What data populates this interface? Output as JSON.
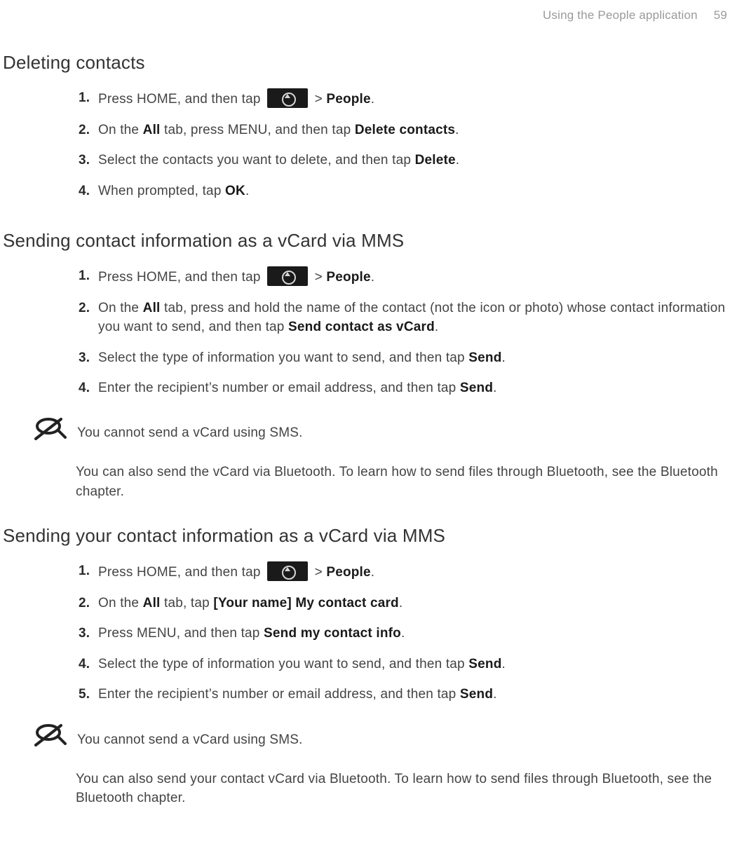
{
  "header": {
    "chapter": "Using the People application",
    "page": "59"
  },
  "heading_deleting": "Deleting contacts",
  "step_d1_a": "Press HOME, and then tap ",
  "step_d1_b": " > ",
  "step_d1_c": "People",
  "step_d1_d": ".",
  "step_d2_a": "On the ",
  "step_d2_b": "All",
  "step_d2_c": " tab, press MENU, and then tap ",
  "step_d2_d": "Delete contacts",
  "step_d2_e": ".",
  "step_d3_a": "Select the contacts you want to delete, and then tap ",
  "step_d3_b": "Delete",
  "step_d3_c": ".",
  "step_d4_a": "When prompted, tap ",
  "step_d4_b": "OK",
  "step_d4_c": ".",
  "heading_sending_contact": "Sending contact information as a vCard via MMS",
  "step_s1_a": "Press HOME, and then tap ",
  "step_s1_b": " > ",
  "step_s1_c": "People",
  "step_s1_d": ".",
  "step_s2_a": "On the ",
  "step_s2_b": "All",
  "step_s2_c": " tab, press and hold the name of the contact (not the icon or photo) whose contact information you want to send, and then tap ",
  "step_s2_d": "Send contact as vCard",
  "step_s2_e": ".",
  "step_s3_a": "Select the type of information you want to send, and then tap ",
  "step_s3_b": "Send",
  "step_s3_c": ".",
  "step_s4_a": "Enter the recipient’s number or email address, and then tap ",
  "step_s4_b": "Send",
  "step_s4_c": ".",
  "note1": "You cannot send a vCard using SMS.",
  "followup1": "You can also send the vCard via Bluetooth. To learn how to send files through Bluetooth, see the Bluetooth chapter.",
  "heading_sending_your": "Sending your contact information as a vCard via MMS",
  "step_y1_a": "Press HOME, and then tap ",
  "step_y1_b": " > ",
  "step_y1_c": "People",
  "step_y1_d": ".",
  "step_y2_a": "On the ",
  "step_y2_b": "All",
  "step_y2_c": " tab, tap ",
  "step_y2_d": "[Your name] My contact card",
  "step_y2_e": ".",
  "step_y3_a": "Press MENU, and then tap ",
  "step_y3_b": "Send my contact info",
  "step_y3_c": ".",
  "step_y4_a": "Select the type of information you want to send, and then tap ",
  "step_y4_b": "Send",
  "step_y4_c": ".",
  "step_y5_a": "Enter the recipient’s number or email address, and then tap ",
  "step_y5_b": "Send",
  "step_y5_c": ".",
  "note2": "You cannot send a vCard using SMS.",
  "followup2": "You can also send your contact vCard via Bluetooth. To learn how to send files through Bluetooth, see the Bluetooth chapter."
}
